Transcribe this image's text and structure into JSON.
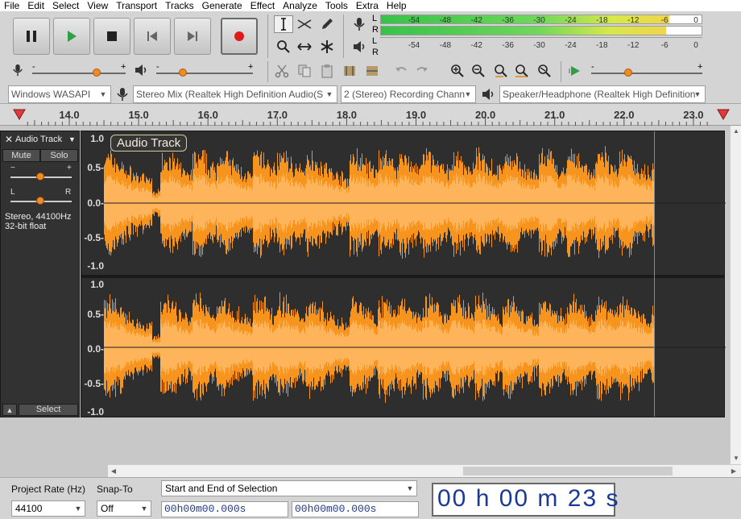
{
  "menu": [
    "File",
    "Edit",
    "Select",
    "View",
    "Transport",
    "Tracks",
    "Generate",
    "Effect",
    "Analyze",
    "Tools",
    "Extra",
    "Help"
  ],
  "meters": {
    "record_label_l": "L",
    "record_label_r": "R",
    "scale": [
      "-54",
      "-48",
      "-42",
      "-36",
      "-30",
      "-24",
      "-18",
      "-12",
      "-6",
      "0"
    ],
    "record_level": 0.9,
    "playback_level": 0.0
  },
  "devices": {
    "host": "Windows WASAPI",
    "recording_device": "Stereo Mix (Realtek High Definition Audio(S",
    "recording_channels": "2 (Stereo) Recording Chann",
    "playback_device": "Speaker/Headphone (Realtek High Definition"
  },
  "ruler": {
    "ticks": [
      "14.0",
      "15.0",
      "16.0",
      "17.0",
      "18.0",
      "19.0",
      "20.0",
      "21.0",
      "22.0",
      "23.0"
    ]
  },
  "track": {
    "name": "Audio Track",
    "mute": "Mute",
    "solo": "Solo",
    "gain_minus": "−",
    "gain_plus": "+",
    "pan_left": "L",
    "pan_right": "R",
    "info_line1": "Stereo, 44100Hz",
    "info_line2": "32-bit float",
    "select": "Select",
    "clip_name": "Audio Track",
    "scale": [
      "1.0",
      "0.5-",
      "0.0-",
      "-0.5-",
      "-1.0"
    ]
  },
  "selection_toolbar": {
    "project_rate_label": "Project Rate (Hz)",
    "project_rate_value": "44100",
    "snap_to_label": "Snap-To",
    "snap_to_value": "Off",
    "selection_mode": "Start and End of Selection",
    "start_time": "00h00m00.000s",
    "end_time": "00h00m00.000s",
    "audio_position": "00 h 00 m 23 s"
  },
  "colors": {
    "waveform": "#f7941d",
    "waveform_rms": "#fdb45a",
    "track_bg": "#2e2e2e",
    "record_button": "#e01a1a"
  }
}
